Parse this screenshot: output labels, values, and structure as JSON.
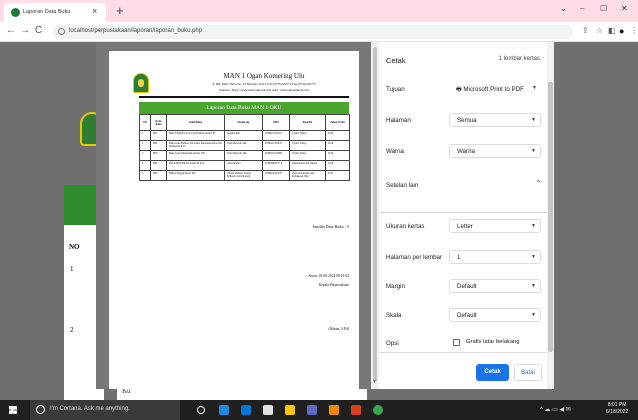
{
  "browser": {
    "tab_title": "Laporan Data Buku",
    "tab_close": "×",
    "new_tab": "+",
    "url": "localhost/perpustakaan/laporan/laporan_buku.php",
    "nav_back": "←",
    "nav_forward": "→",
    "nav_reload": "C",
    "win_min": "–",
    "win_max": "☐",
    "win_close": "✕",
    "win_chevron": "⌄"
  },
  "document": {
    "school": "MAN 1 Ogan Komering Ulu",
    "address": "Jl. DR. Moh. Hatta No. 63 Baturaja 32112 Telp (0735)320772 Fax (0735)320772",
    "website": "Website : https://www.man1oku.sch.id E-mail : man1oku@gmail.com",
    "table_title": "Laporan Data Buku MAN 1 OKU",
    "columns": [
      "NO",
      "Kode Buku",
      "Judul Buku",
      "Pengarang",
      "ISBN",
      "Penerbit",
      "Tahun Terbit"
    ],
    "rows": [
      [
        "1",
        "B01",
        "Buku Fiqih Kls Siswa Ali Permana Kelas XI",
        "Susanti, dkk",
        "9786021703119",
        "Yrama Widya",
        "2019"
      ],
      [
        "2",
        "B02",
        "Buku Guru Bahasa dan Sastra Indonesia Kelas XII Peminatan K13",
        "Tudi Mulyadi, dkk",
        "9786021703447",
        "Yrama Widya",
        "2019"
      ],
      [
        "3",
        "B03",
        "Buku Guru Matematika Kelas XII",
        "Tudi Mulyadi, dkk",
        "9786021702986",
        "Yrama Widya",
        "2016"
      ],
      [
        "4",
        "B04",
        "PAI & Budi Pekerti Kelas XI K13",
        "Aziz Parento",
        "9786026447713",
        "Kementerian RI, Jakarta",
        "2016"
      ],
      [
        "5",
        "B05",
        "Bahasa Inggris Kelas XII",
        "Umam Ukhrun, Zubair Bahrudi, dan Peranadi",
        "9786022297479",
        "Pusat Kurikulum dan Perbukuan, Bali",
        "2015"
      ]
    ],
    "total": "Jumlah Data Buku : 5",
    "date": "Senin, 18-06-2022 08:01:02",
    "role": "Kepala Perpustakaan",
    "signer": "(Ikhsan, S.Pd)"
  },
  "background_page": {
    "no_header": "NO",
    "row1": "1",
    "row2": "2",
    "footer_text": "Ku"
  },
  "print": {
    "title": "Cetak",
    "sheets": "1 lembar kertas",
    "tujuan_label": "Tujuan",
    "tujuan_value": "Microsoft Print to PDF",
    "halaman_label": "Halaman",
    "halaman_value": "Semua",
    "warna_label": "Warna",
    "warna_value": "Warna",
    "more_label": "Setelan lain",
    "ukuran_label": "Ukuran kertas",
    "ukuran_value": "Letter",
    "hpl_label": "Halaman per lembar",
    "hpl_value": "1",
    "margin_label": "Margin",
    "margin_value": "Default",
    "skala_label": "Skala",
    "skala_value": "Default",
    "opsi_label": "Opsi",
    "opsi_checkbox": "Grafis latar belakang",
    "print_button": "Cetak",
    "cancel_button": "Batal"
  },
  "taskbar": {
    "search_placeholder": "I'm Cortana. Ask me anything.",
    "time": "8:01 PM",
    "date": "6/18/2022"
  },
  "colors": {
    "accent": "#1a73e8",
    "report_header": "#4aa52e",
    "tab_strip": "#ffdce6"
  }
}
